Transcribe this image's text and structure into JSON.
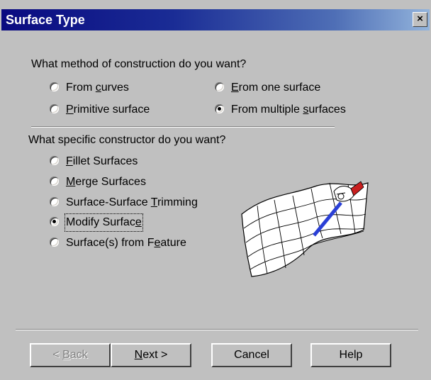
{
  "window": {
    "title": "Surface Type",
    "close_label": "×"
  },
  "method": {
    "question": "What method of construction do you want?",
    "options": [
      {
        "pre": "From ",
        "acc": "c",
        "post": "urves",
        "checked": false
      },
      {
        "pre": "",
        "acc": "E",
        "post": "rom one surface",
        "checked": false
      },
      {
        "pre": "",
        "acc": "P",
        "post": "rimitive surface",
        "checked": false
      },
      {
        "pre": "From multiple ",
        "acc": "s",
        "post": "urfaces",
        "checked": true
      }
    ]
  },
  "constructor": {
    "question": "What specific constructor do you want?",
    "options": [
      {
        "pre": "",
        "acc": "F",
        "post": "illet Surfaces",
        "checked": false
      },
      {
        "pre": "",
        "acc": "M",
        "post": "erge Surfaces",
        "checked": false
      },
      {
        "pre": "Surface-Surface ",
        "acc": "T",
        "post": "rimming",
        "checked": false
      },
      {
        "pre": "Modify Surfac",
        "acc": "e",
        "post": "",
        "checked": true
      },
      {
        "pre": "Surface(s) from F",
        "acc": "e",
        "post": "ature",
        "checked": false
      }
    ]
  },
  "buttons": {
    "back": {
      "pre": "< ",
      "acc": "B",
      "post": "ack",
      "enabled": false
    },
    "next": {
      "pre": "",
      "acc": "N",
      "post": "ext >",
      "enabled": true
    },
    "cancel": {
      "label": "Cancel"
    },
    "help": {
      "label": "Help"
    }
  },
  "illustration": {
    "icon": "modify-surface-illustration",
    "accent": "#2a3fd6",
    "handle": "#c81e1e"
  }
}
